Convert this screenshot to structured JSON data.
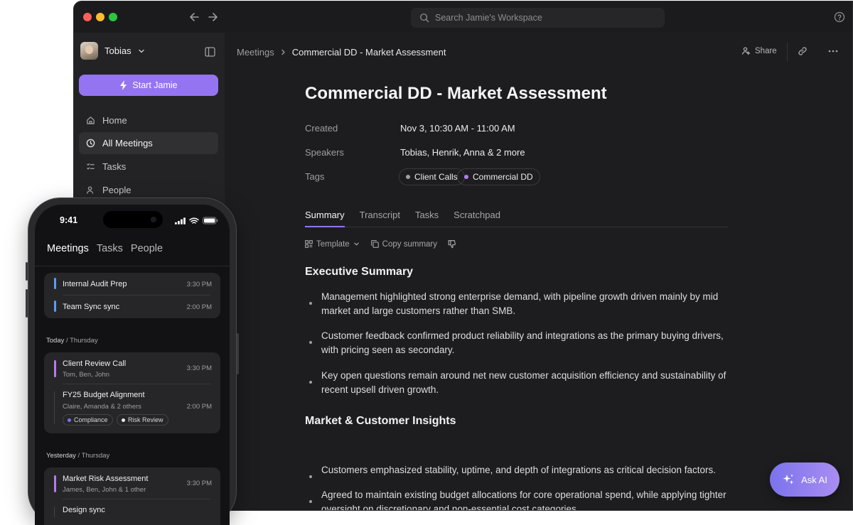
{
  "app": {
    "search_placeholder": "Search Jamie's Workspace"
  },
  "sidebar": {
    "user_name": "Tobias",
    "start_button": "Start Jamie",
    "items": [
      {
        "label": "Home",
        "icon": "home-icon"
      },
      {
        "label": "All Meetings",
        "icon": "clock-icon",
        "active": true
      },
      {
        "label": "Tasks",
        "icon": "tasks-icon"
      },
      {
        "label": "People",
        "icon": "people-icon"
      }
    ]
  },
  "header": {
    "breadcrumb": [
      "Meetings",
      "Commercial DD - Market Assessment"
    ],
    "share_label": "Share"
  },
  "document": {
    "title": "Commercial DD - Market Assessment",
    "meta": [
      {
        "label": "Created",
        "value": "Nov 3, 10:30 AM - 11:00 AM"
      },
      {
        "label": "Speakers",
        "value": "Tobias, Henrik, Anna & 2 more"
      },
      {
        "label": "Tags",
        "value": ""
      }
    ],
    "tags": [
      {
        "label": "Client Calls",
        "color": "#a0a0a4"
      },
      {
        "label": "Commercial DD",
        "color": "#b47cf0"
      }
    ],
    "tabs": [
      "Summary",
      "Transcript",
      "Tasks",
      "Scratchpad"
    ],
    "toolbar": {
      "template": "Template",
      "copy": "Copy summary"
    },
    "sections": [
      {
        "heading": "Executive Summary",
        "bullets": [
          "Management highlighted strong enterprise demand, with pipeline growth driven mainly by mid market and large customers rather than SMB.",
          "Customer feedback confirmed product reliability and integrations as the primary buying drivers, with pricing seen as secondary.",
          "Key open questions remain around net new customer acquisition efficiency and sustainability of recent upsell driven growth."
        ]
      },
      {
        "heading": "Market & Customer Insights",
        "bullets": [
          "Customers emphasized stability, uptime, and depth of integrations as critical decision factors.",
          "Agreed to maintain existing budget allocations for core operational spend, while applying tighter oversight on discretionary and non-essential cost categories."
        ]
      }
    ]
  },
  "ask_ai": {
    "label": "Ask AI"
  },
  "phone": {
    "time": "9:41",
    "tabs": [
      "Meetings",
      "Tasks",
      "People"
    ],
    "groups": [
      {
        "meetings": [
          {
            "title": "Internal Audit Prep",
            "time": "3:30 PM",
            "color": "#5b9cf0"
          },
          {
            "title": "Team Sync sync",
            "time": "2:00 PM",
            "color": "#5b9cf0"
          }
        ]
      },
      {
        "day": "Today",
        "weekday": "/ Thursday",
        "meetings": [
          {
            "title": "Client Review Call",
            "sub": "Tom, Ben, John",
            "time": "3:30 PM",
            "color": "#b47cf0"
          },
          {
            "title": "FY25 Budget Alignment",
            "sub": "Claire, Amanda & 2 others",
            "time": "2:00 PM",
            "color": "#444447",
            "tags": [
              {
                "label": "Compliance",
                "color": "#7d73ec"
              },
              {
                "label": "Risk Review",
                "color": "#e8e8ea"
              }
            ]
          }
        ]
      },
      {
        "day": "Yesterday",
        "weekday": "/ Thursday",
        "meetings": [
          {
            "title": "Market Risk Assessment",
            "sub": "James, Ben, John & 1 other",
            "time": "3:30 PM",
            "color": "#b47cf0"
          },
          {
            "title": "Design sync",
            "color": "#444447"
          }
        ]
      }
    ]
  }
}
